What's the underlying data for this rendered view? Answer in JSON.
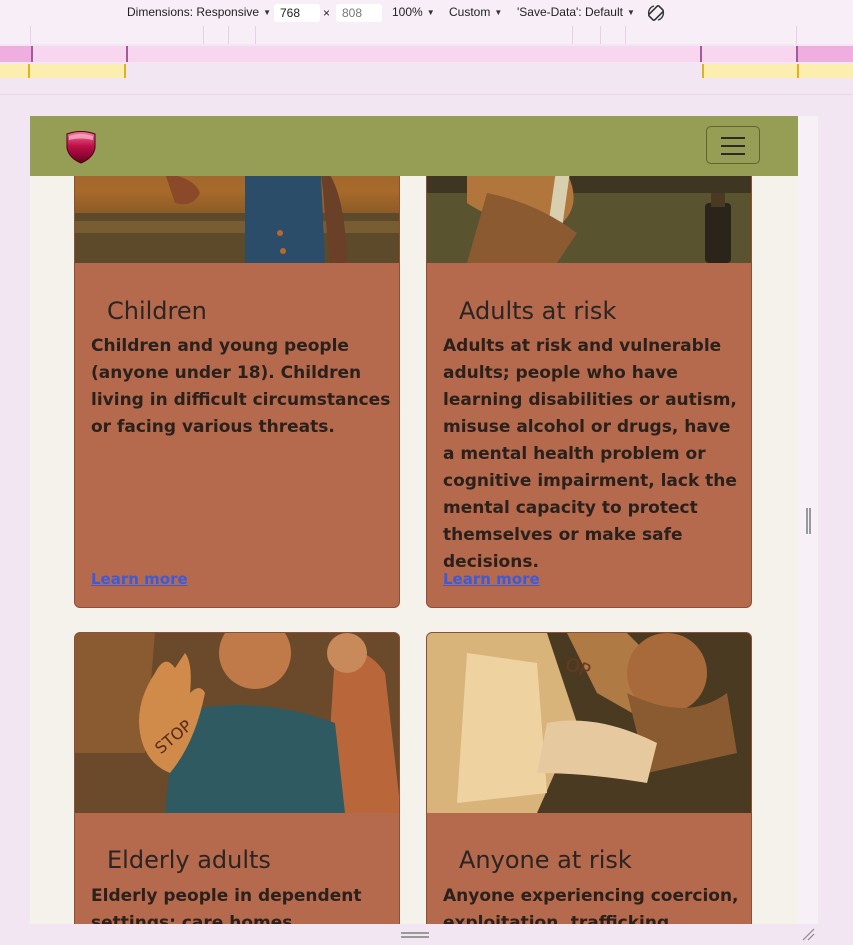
{
  "devtools": {
    "dimensions_label": "Dimensions: Responsive",
    "width_value": "768",
    "times": "×",
    "height_value": "808",
    "zoom": "100%",
    "throttle": "Custom",
    "save_data": "'Save-Data': Default",
    "rotate_icon": "rotate-icon"
  },
  "navbar": {
    "logo_icon": "shield-logo-icon",
    "toggler_icon": "hamburger-icon"
  },
  "cards": [
    {
      "title": "Children",
      "text": "Children and young people (anyone under 18). Children living in difficult circumstances or facing various threats.",
      "link": "Learn more"
    },
    {
      "title": "Adults at risk",
      "text": "Adults at risk and vulnerable adults; people who have learning disabilities or autism, misuse alcohol or drugs, have a mental health problem or cognitive impairment, lack the mental capacity to protect themselves or make safe decisions.",
      "link": "Learn more"
    },
    {
      "title": "Elderly adults",
      "text": "Elderly people in dependent settings: care homes, hospitals,"
    },
    {
      "title": "Anyone at risk",
      "text": "Anyone experiencing coercion, exploitation, trafficking, modern"
    }
  ],
  "colors": {
    "navbar": "#969d55",
    "card": "#b5694d",
    "link": "#3b5bdb",
    "page": "#f5f2ec"
  }
}
